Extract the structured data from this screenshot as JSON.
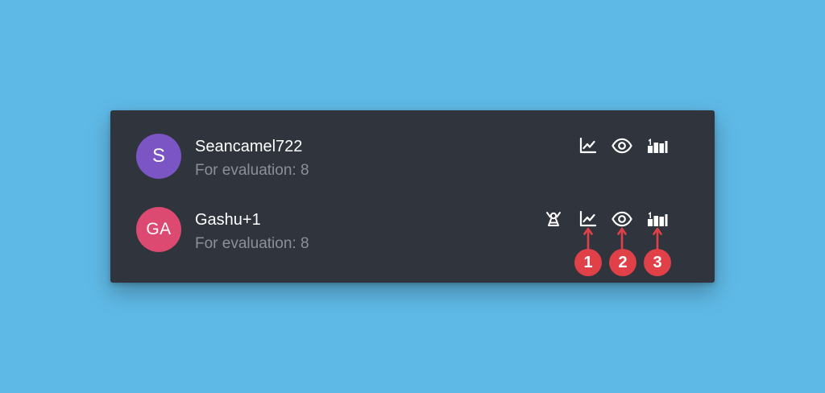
{
  "colors": {
    "background": "#5fb9e6",
    "card": "#2f343d",
    "name_text": "#ffffff",
    "sub_text": "#8b9099",
    "marker": "#e04048"
  },
  "users": [
    {
      "avatar_initials": "S",
      "avatar_color": "#7b55c4",
      "name": "Seancamel722",
      "subtitle": "For evaluation: 8",
      "icons": [
        "line-chart-icon",
        "eye-icon",
        "ranking-bars-icon"
      ]
    },
    {
      "avatar_initials": "GA",
      "avatar_color": "#dc4a72",
      "name": "Gashu+1",
      "subtitle": "For evaluation: 8",
      "icons": [
        "cheer-person-icon",
        "line-chart-icon",
        "eye-icon",
        "ranking-bars-icon"
      ]
    }
  ],
  "markers": [
    {
      "label": "1",
      "points_to": "line-chart-icon"
    },
    {
      "label": "2",
      "points_to": "eye-icon"
    },
    {
      "label": "3",
      "points_to": "ranking-bars-icon"
    }
  ]
}
